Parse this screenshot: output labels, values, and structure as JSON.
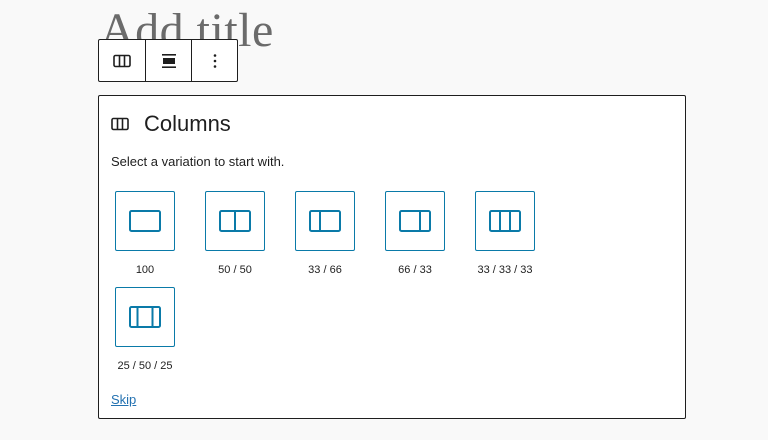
{
  "editor": {
    "post_title_placeholder": "Add title"
  },
  "block_toolbar": {
    "buttons": [
      {
        "name": "block-type-columns",
        "icon": "columns-icon"
      },
      {
        "name": "align",
        "icon": "align-wide-icon"
      },
      {
        "name": "more-options",
        "icon": "more-vertical-icon"
      }
    ]
  },
  "placeholder": {
    "icon": "columns-icon",
    "title": "Columns",
    "instructions": "Select a variation to start with.",
    "variations": [
      {
        "label": "100",
        "icon": "column-100-icon"
      },
      {
        "label": "50 / 50",
        "icon": "columns-50-50-icon"
      },
      {
        "label": "33 / 66",
        "icon": "columns-33-66-icon"
      },
      {
        "label": "66 / 33",
        "icon": "columns-66-33-icon"
      },
      {
        "label": "33 / 33 / 33",
        "icon": "columns-33-33-33-icon"
      },
      {
        "label": "25 / 50 / 25",
        "icon": "columns-25-50-25-icon"
      }
    ],
    "skip_label": "Skip"
  },
  "colors": {
    "accent": "#0a7aa8",
    "text": "#1e1e1e",
    "background": "#f9f9f9",
    "link": "#2271b1"
  }
}
